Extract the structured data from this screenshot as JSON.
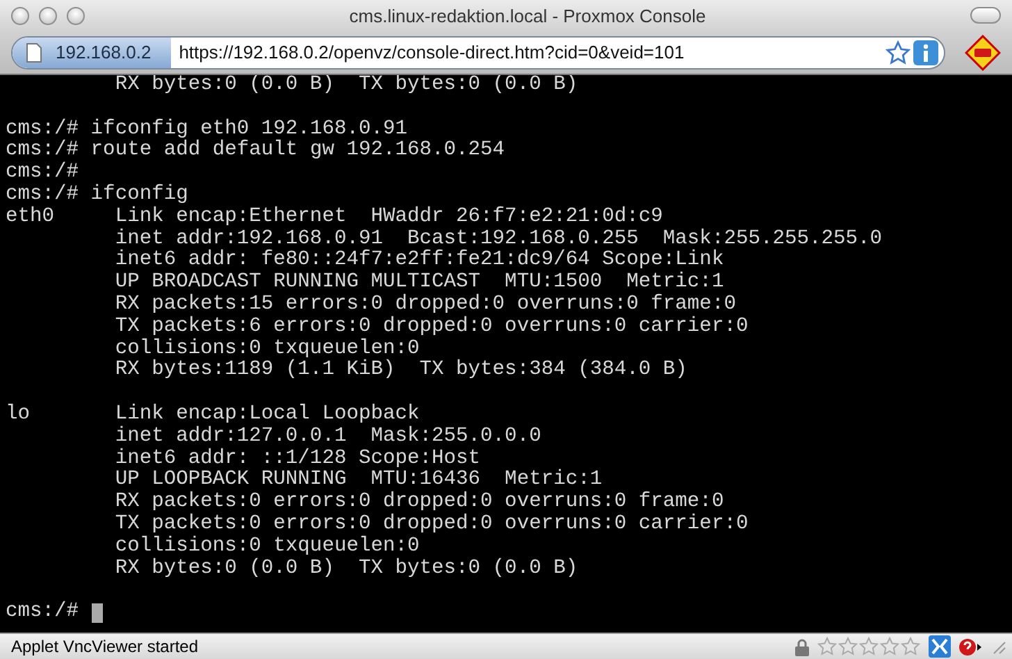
{
  "window": {
    "title": "cms.linux-redaktion.local - Proxmox Console"
  },
  "address_bar": {
    "site": "192.168.0.2",
    "url": "https://192.168.0.2/openvz/console-direct.htm?cid=0&veid=101"
  },
  "terminal": {
    "lines": [
      {
        "kind": "detail",
        "text": "RX bytes:0 (0.0 B)  TX bytes:0 (0.0 B)"
      },
      {
        "kind": "blank"
      },
      {
        "kind": "prompt",
        "text": "cms:/# ifconfig eth0 192.168.0.91"
      },
      {
        "kind": "prompt",
        "text": "cms:/# route add default gw 192.168.0.254"
      },
      {
        "kind": "prompt",
        "text": "cms:/#"
      },
      {
        "kind": "prompt",
        "text": "cms:/# ifconfig"
      },
      {
        "kind": "detail",
        "label": "eth0",
        "text": "Link encap:Ethernet  HWaddr 26:f7:e2:21:0d:c9"
      },
      {
        "kind": "detail",
        "text": "inet addr:192.168.0.91  Bcast:192.168.0.255  Mask:255.255.255.0"
      },
      {
        "kind": "detail",
        "text": "inet6 addr: fe80::24f7:e2ff:fe21:dc9/64 Scope:Link"
      },
      {
        "kind": "detail",
        "text": "UP BROADCAST RUNNING MULTICAST  MTU:1500  Metric:1"
      },
      {
        "kind": "detail",
        "text": "RX packets:15 errors:0 dropped:0 overruns:0 frame:0"
      },
      {
        "kind": "detail",
        "text": "TX packets:6 errors:0 dropped:0 overruns:0 carrier:0"
      },
      {
        "kind": "detail",
        "text": "collisions:0 txqueuelen:0"
      },
      {
        "kind": "detail",
        "text": "RX bytes:1189 (1.1 KiB)  TX bytes:384 (384.0 B)"
      },
      {
        "kind": "blank"
      },
      {
        "kind": "detail",
        "label": "lo",
        "text": "Link encap:Local Loopback"
      },
      {
        "kind": "detail",
        "text": "inet addr:127.0.0.1  Mask:255.0.0.0"
      },
      {
        "kind": "detail",
        "text": "inet6 addr: ::1/128 Scope:Host"
      },
      {
        "kind": "detail",
        "text": "UP LOOPBACK RUNNING  MTU:16436  Metric:1"
      },
      {
        "kind": "detail",
        "text": "RX packets:0 errors:0 dropped:0 overruns:0 frame:0"
      },
      {
        "kind": "detail",
        "text": "TX packets:0 errors:0 dropped:0 overruns:0 carrier:0"
      },
      {
        "kind": "detail",
        "text": "collisions:0 txqueuelen:0"
      },
      {
        "kind": "detail",
        "text": "RX bytes:0 (0.0 B)  TX bytes:0 (0.0 B)"
      },
      {
        "kind": "blank"
      },
      {
        "kind": "prompt",
        "text": "cms:/#",
        "cursor": true
      }
    ]
  },
  "status_bar": {
    "text": "Applet VncViewer started",
    "stars": 0
  }
}
